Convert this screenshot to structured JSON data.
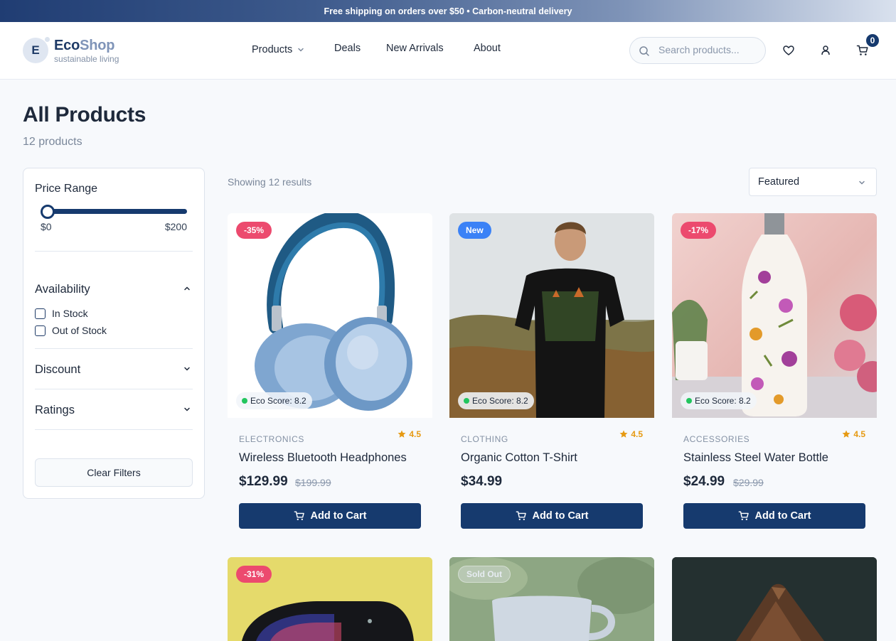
{
  "banner": {
    "text": "Free shipping on orders over $50 • Carbon-neutral delivery"
  },
  "header": {
    "logo_letter": "E",
    "logo_name_a": "Eco",
    "logo_name_b": "Shop",
    "logo_tagline": "sustainable living",
    "nav": [
      {
        "label": "Products",
        "has_dropdown": true
      },
      {
        "label": "Deals"
      },
      {
        "label": "New Arrivals"
      },
      {
        "label": "About"
      }
    ],
    "search_placeholder": "Search products...",
    "cart_count": "0",
    "icons": [
      "search-icon",
      "heart-icon",
      "user-icon",
      "cart-icon"
    ]
  },
  "page": {
    "title": "All Products",
    "count": "12 products"
  },
  "filters": {
    "price": {
      "heading": "Price Range",
      "min": "$0",
      "max": "$200",
      "selected_min": 0,
      "selected_max": 200
    },
    "availability": {
      "heading": "Availability",
      "expanded": true,
      "options": [
        "In Stock",
        "Out of Stock"
      ]
    },
    "discount": {
      "heading": "Discount",
      "expanded": false
    },
    "ratings": {
      "heading": "Ratings",
      "expanded": false
    },
    "clear_label": "Clear Filters"
  },
  "results": {
    "text": "Showing 12 results",
    "sort_value": "Featured"
  },
  "products": [
    {
      "badge": "-35%",
      "badge_type": "sale",
      "eco": "Eco Score: 8.2",
      "category": "ELECTRONICS",
      "rating": "4.5",
      "name": "Wireless Bluetooth Headphones",
      "price": "$129.99",
      "old_price": "$199.99",
      "cta": "Add to Cart"
    },
    {
      "badge": "New",
      "badge_type": "new",
      "eco": "Eco Score: 8.2",
      "category": "CLOTHING",
      "rating": "4.5",
      "name": "Organic Cotton T-Shirt",
      "price": "$34.99",
      "old_price": "",
      "cta": "Add to Cart"
    },
    {
      "badge": "-17%",
      "badge_type": "sale",
      "eco": "Eco Score: 8.2",
      "category": "ACCESSORIES",
      "rating": "4.5",
      "name": "Stainless Steel Water Bottle",
      "price": "$24.99",
      "old_price": "$29.99",
      "cta": "Add to Cart"
    },
    {
      "badge": "-31%",
      "badge_type": "sale"
    },
    {
      "badge": "Sold Out",
      "badge_type": "sold"
    },
    {
      "badge": "",
      "badge_type": ""
    }
  ],
  "colors": {
    "primary": "#163a6e",
    "sale": "#ec4a6e",
    "new": "#3b82f6",
    "star": "#e69a13",
    "eco_dot": "#22c55e"
  }
}
